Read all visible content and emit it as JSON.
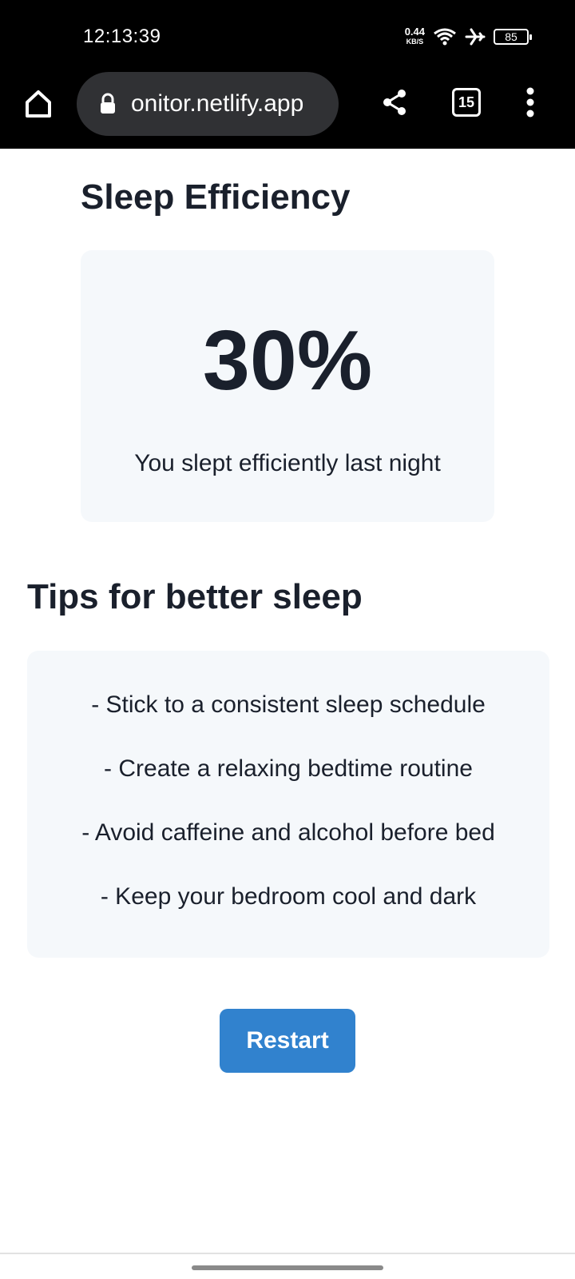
{
  "status_bar": {
    "time": "12:13:39",
    "net_speed": "0.44",
    "net_unit": "KB/S",
    "battery": "85"
  },
  "browser": {
    "url": "onitor.netlify.app",
    "tab_count": "15"
  },
  "page": {
    "title": "Sleep Efficiency",
    "efficiency_value": "30%",
    "efficiency_text": "You slept efficiently last night",
    "tips_title": "Tips for better sleep",
    "tips": [
      "- Stick to a consistent sleep schedule",
      "- Create a relaxing bedtime routine",
      "- Avoid caffeine and alcohol before bed",
      "- Keep your bedroom cool and dark"
    ],
    "restart_label": "Restart"
  },
  "colors": {
    "card_background": "#f5f8fb",
    "primary_button": "#3182ce",
    "text": "#1a202c"
  }
}
